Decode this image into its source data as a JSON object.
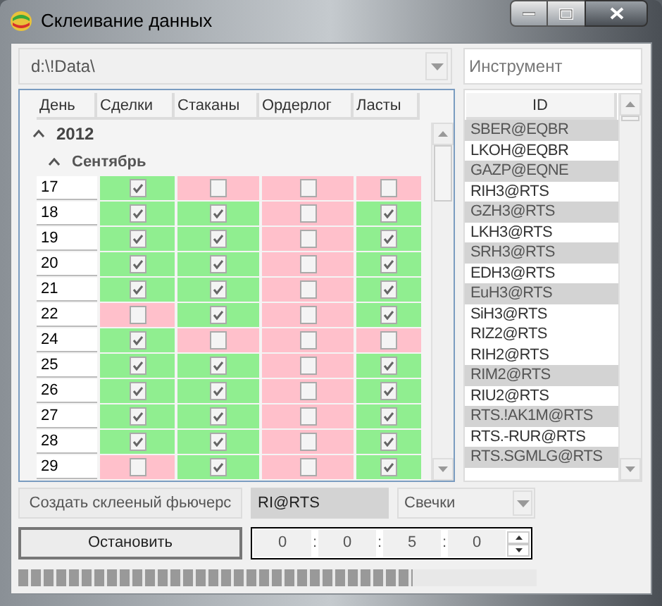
{
  "window": {
    "title": "Склеивание данных"
  },
  "path_combo": {
    "value": "d:\\!Data\\"
  },
  "instrument_field": {
    "placeholder": "Инструмент"
  },
  "grid": {
    "columns": [
      "День",
      "Сделки",
      "Стаканы",
      "Ордерлог",
      "Ласты"
    ],
    "year": {
      "label": "2012",
      "expanded": true
    },
    "month": {
      "label": "Сентябрь",
      "expanded": true
    },
    "rows": [
      {
        "day": "17",
        "checks": [
          true,
          false,
          false,
          false
        ]
      },
      {
        "day": "18",
        "checks": [
          true,
          true,
          false,
          true
        ]
      },
      {
        "day": "19",
        "checks": [
          true,
          true,
          false,
          true
        ]
      },
      {
        "day": "20",
        "checks": [
          true,
          true,
          false,
          true
        ]
      },
      {
        "day": "21",
        "checks": [
          true,
          true,
          false,
          true
        ]
      },
      {
        "day": "22",
        "checks": [
          false,
          true,
          false,
          true
        ]
      },
      {
        "day": "24",
        "checks": [
          true,
          false,
          false,
          false
        ]
      },
      {
        "day": "25",
        "checks": [
          true,
          true,
          false,
          true
        ]
      },
      {
        "day": "26",
        "checks": [
          true,
          true,
          false,
          true
        ]
      },
      {
        "day": "27",
        "checks": [
          true,
          true,
          false,
          true
        ]
      },
      {
        "day": "28",
        "checks": [
          true,
          true,
          false,
          true
        ]
      },
      {
        "day": "29",
        "checks": [
          false,
          true,
          false,
          true
        ]
      }
    ]
  },
  "id_list": {
    "header": "ID",
    "items": [
      {
        "label": "SBER@EQBR",
        "selected": true
      },
      {
        "label": "LKOH@EQBR",
        "selected": false
      },
      {
        "label": "GAZP@EQNE",
        "selected": true
      },
      {
        "label": "RIH3@RTS",
        "selected": false
      },
      {
        "label": "GZH3@RTS",
        "selected": true
      },
      {
        "label": "LKH3@RTS",
        "selected": false
      },
      {
        "label": "SRH3@RTS",
        "selected": true
      },
      {
        "label": "EDH3@RTS",
        "selected": false
      },
      {
        "label": "EuH3@RTS",
        "selected": true
      },
      {
        "label": "SiH3@RTS",
        "selected": false
      },
      {
        "label": "RIZ2@RTS",
        "selected": false
      },
      {
        "label": "RIH2@RTS",
        "selected": false
      },
      {
        "label": "RIM2@RTS",
        "selected": true
      },
      {
        "label": "RIU2@RTS",
        "selected": false
      },
      {
        "label": "RTS.!AK1M@RTS",
        "selected": true
      },
      {
        "label": "RTS.-RUR@RTS",
        "selected": false
      },
      {
        "label": "RTS.SGMLG@RTS",
        "selected": true
      }
    ]
  },
  "create_button": {
    "label": "Создать склееный фьючерс"
  },
  "security_field": {
    "value": "RI@RTS"
  },
  "type_combo": {
    "value": "Свечки"
  },
  "stop_button": {
    "label": "Остановить"
  },
  "timer": {
    "parts": [
      "0",
      "0",
      "5",
      "0"
    ],
    "separators": [
      ":",
      ":",
      ":"
    ]
  },
  "progress": {
    "level": 0.76
  }
}
